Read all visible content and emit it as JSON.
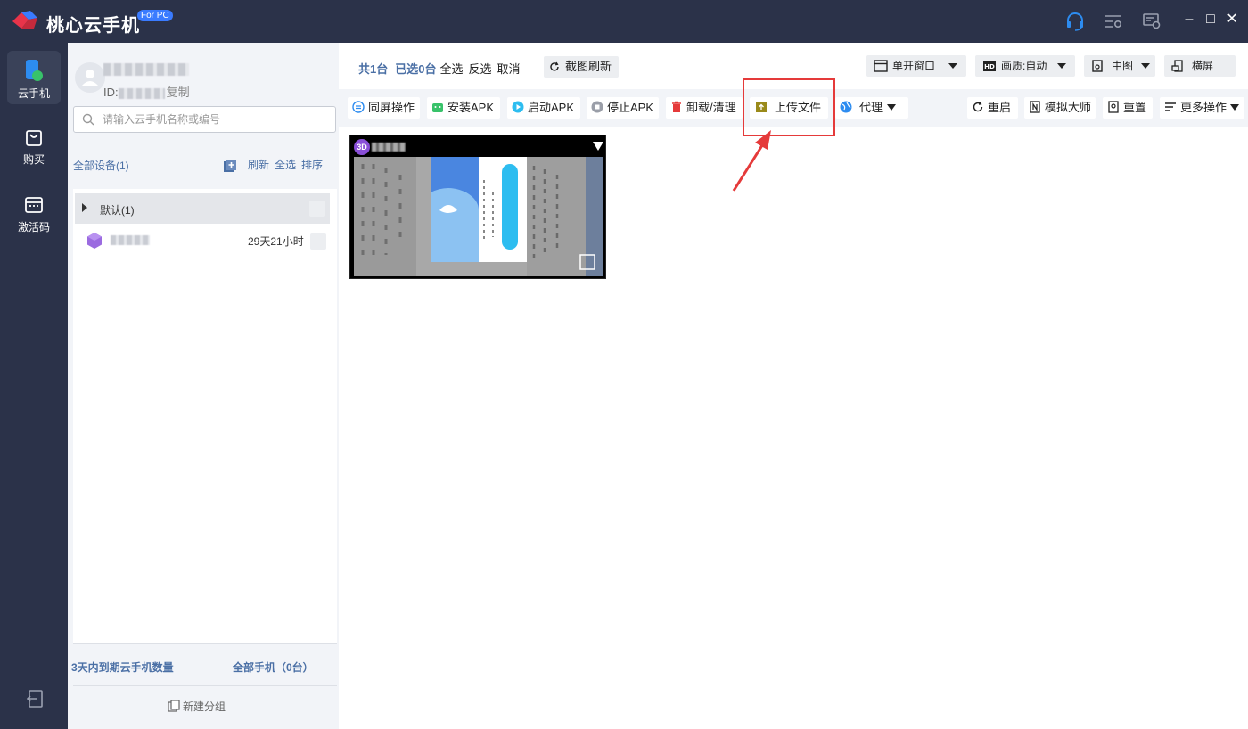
{
  "app": {
    "title": "桃心云手机",
    "badge": "For PC"
  },
  "nav": [
    {
      "label": "云手机",
      "icon": "phone-icon",
      "active": true
    },
    {
      "label": "购买",
      "icon": "shopping-bag-icon",
      "active": false
    },
    {
      "label": "激活码",
      "icon": "activation-code-icon",
      "active": false
    }
  ],
  "user": {
    "id_label": "ID:",
    "copy_label": "复制"
  },
  "search": {
    "placeholder": "请输入云手机名称或编号"
  },
  "devices_panel": {
    "all_devices_label": "全部设备(1)",
    "actions": [
      "刷新",
      "全选",
      "排序"
    ],
    "group_label": "默认(1)",
    "device_time": "29天21小时",
    "expire_label": "3天内到期云手机数量",
    "all_phones_label": "全部手机（0台）",
    "new_group_label": "新建分组"
  },
  "stats": {
    "total": "共1台",
    "selected": "已选0台",
    "select_all": "全选",
    "invert": "反选",
    "cancel": "取消",
    "screenshot_refresh": "截图刷新"
  },
  "top_right": {
    "window_mode": "单开窗口",
    "quality": "画质:自动",
    "size": "中图",
    "orientation": "横屏"
  },
  "toolbar": {
    "sync": "同屏操作",
    "install_apk": "安装APK",
    "start_apk": "启动APK",
    "stop_apk": "停止APK",
    "uninstall": "卸载/清理",
    "upload": "上传文件",
    "proxy": "代理",
    "restart": "重启",
    "simulator": "模拟大师",
    "reset": "重置",
    "more": "更多操作"
  },
  "thumbnail": {
    "badge": "3D"
  },
  "colors": {
    "titlebar": "#2b3249",
    "accent": "#4a6fa5",
    "highlight": "#e53a3a"
  }
}
